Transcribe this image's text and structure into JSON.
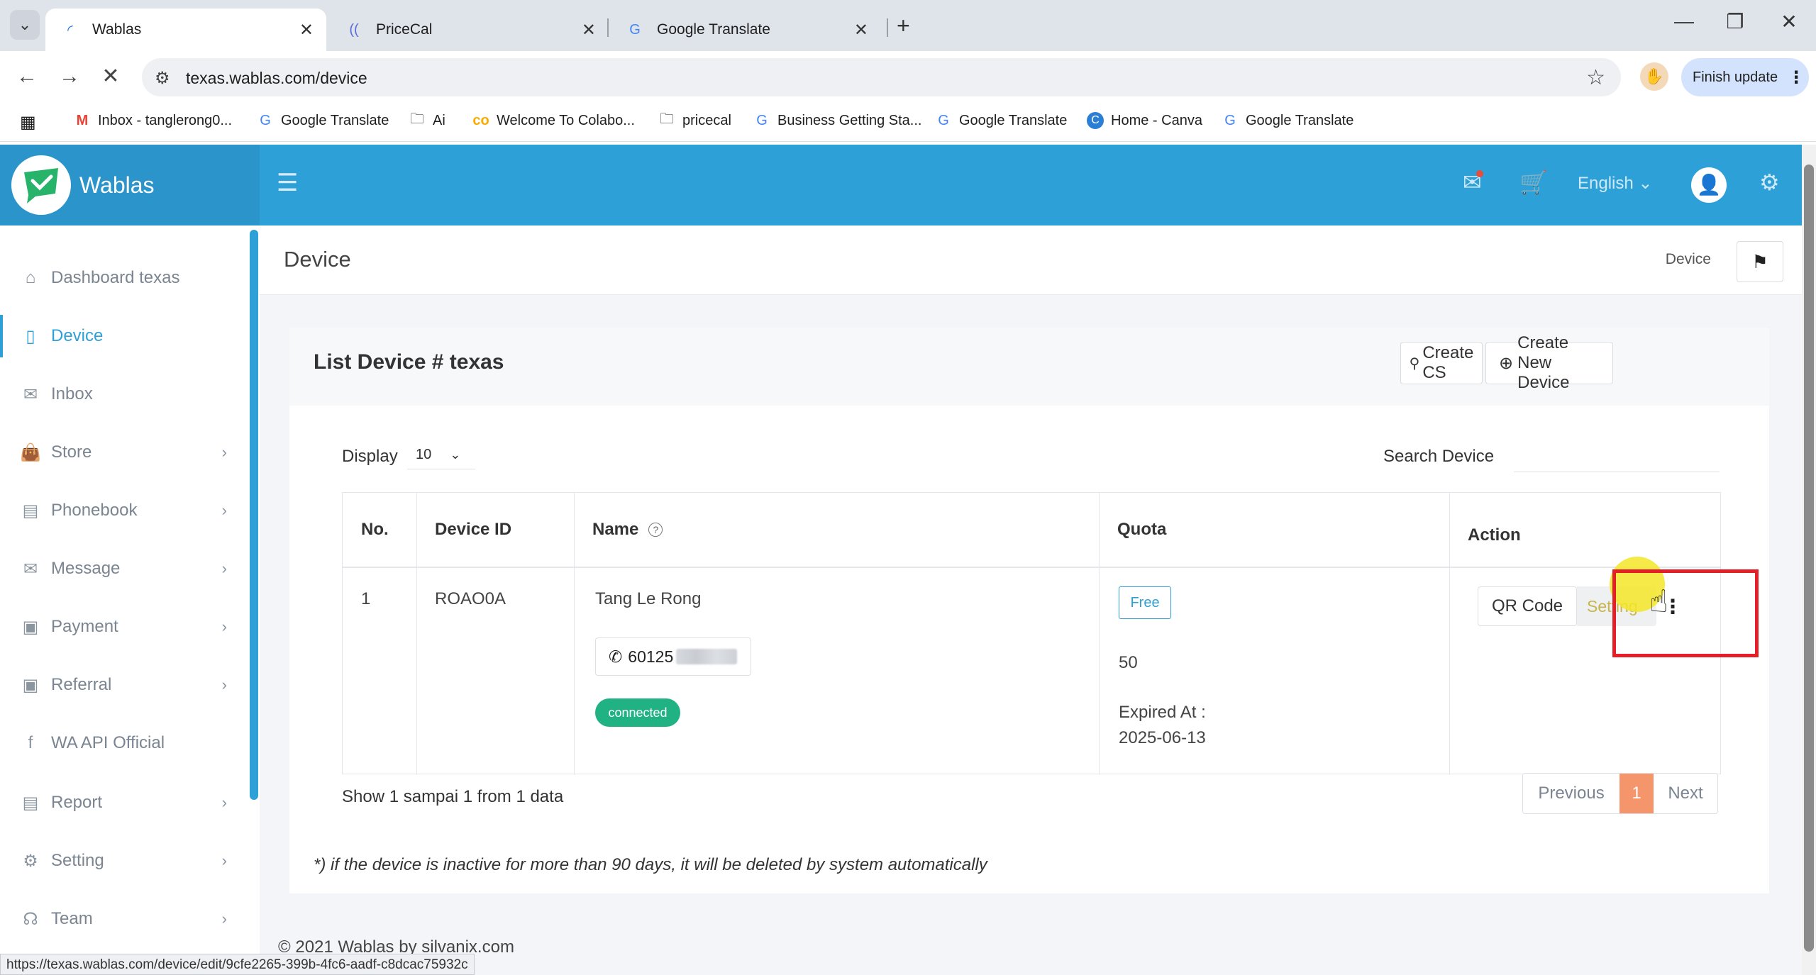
{
  "browser": {
    "tabs": [
      {
        "title": "Wablas",
        "active": true
      },
      {
        "title": "PriceCal",
        "active": false
      },
      {
        "title": "Google Translate",
        "active": false
      }
    ],
    "url": "texas.wablas.com/device",
    "finish_update": "Finish update",
    "bookmarks": [
      "Inbox - tanglerong0...",
      "Google Translate",
      "Ai",
      "Welcome To Colabo...",
      "pricecal",
      "Business Getting Sta...",
      "Google Translate",
      "Home - Canva",
      "Google Translate"
    ],
    "status_url": "https://texas.wablas.com/device/edit/9cfe2265-399b-4fc6-aadf-c8dcac75932c"
  },
  "app": {
    "brand": "Wablas",
    "language": "English",
    "accent": "#2ea0d8"
  },
  "sidebar": {
    "items": [
      {
        "label": "Dashboard texas",
        "icon": "home-icon",
        "chevron": false
      },
      {
        "label": "Device",
        "icon": "device-icon",
        "chevron": false,
        "active": true
      },
      {
        "label": "Inbox",
        "icon": "inbox-icon",
        "chevron": false
      },
      {
        "label": "Store",
        "icon": "bag-icon",
        "chevron": true
      },
      {
        "label": "Phonebook",
        "icon": "phonebook-icon",
        "chevron": true
      },
      {
        "label": "Message",
        "icon": "envelope-icon",
        "chevron": true
      },
      {
        "label": "Payment",
        "icon": "wallet-icon",
        "chevron": true
      },
      {
        "label": "Referral",
        "icon": "referral-icon",
        "chevron": true
      },
      {
        "label": "WA API Official",
        "icon": "facebook-icon",
        "chevron": false
      },
      {
        "label": "Report",
        "icon": "report-icon",
        "chevron": true
      },
      {
        "label": "Setting",
        "icon": "gear-icon",
        "chevron": true
      },
      {
        "label": "Team",
        "icon": "headset-icon",
        "chevron": true
      }
    ]
  },
  "page": {
    "title": "Device",
    "breadcrumb": "Device"
  },
  "card": {
    "title": "List Device # texas",
    "create_cs": "Create CS",
    "create_device": "Create New Device",
    "display_label": "Display",
    "display_value": "10",
    "search_label": "Search Device",
    "columns": [
      "No.",
      "Device ID",
      "Name",
      "Quota",
      "Action"
    ],
    "rows": [
      {
        "no": "1",
        "device_id": "ROAO0A",
        "name": "Tang Le Rong",
        "phone": "60125",
        "status": "connected",
        "plan": "Free",
        "quota": "50",
        "expired_label": "Expired At :",
        "expired_date": "2025-06-13",
        "qr_label": "QR Code",
        "setting_label": "Setting"
      }
    ],
    "show_text": "Show 1 sampai 1 from 1 data",
    "pagination": {
      "previous": "Previous",
      "current": "1",
      "next": "Next"
    },
    "note": "*) if the device is inactive for more than 90 days, it will be deleted by system automatically"
  },
  "footer": "© 2021 Wablas by silvanix.com"
}
